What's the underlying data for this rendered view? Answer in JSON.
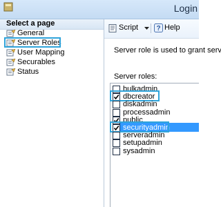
{
  "window": {
    "title": "Login"
  },
  "left_pane": {
    "header": "Select a page",
    "pages": [
      {
        "label": "General",
        "highlighted": false
      },
      {
        "label": "Server Roles",
        "highlighted": true
      },
      {
        "label": "User Mapping",
        "highlighted": false
      },
      {
        "label": "Securables",
        "highlighted": false
      },
      {
        "label": "Status",
        "highlighted": false
      }
    ]
  },
  "toolbar": {
    "script_label": "Script",
    "help_label": "Help"
  },
  "main": {
    "description": "Server role is used to grant serv",
    "roles_label": "Server roles:",
    "roles": [
      {
        "name": "bulkadmin",
        "checked": false,
        "highlighted": false,
        "selected": false
      },
      {
        "name": "dbcreator",
        "checked": true,
        "highlighted": true,
        "selected": false
      },
      {
        "name": "diskadmin",
        "checked": false,
        "highlighted": false,
        "selected": false
      },
      {
        "name": "processadmin",
        "checked": false,
        "highlighted": false,
        "selected": false
      },
      {
        "name": "public",
        "checked": true,
        "highlighted": false,
        "selected": false
      },
      {
        "name": "securityadmin",
        "checked": true,
        "highlighted": true,
        "selected": true
      },
      {
        "name": "serveradmin",
        "checked": false,
        "highlighted": false,
        "selected": false
      },
      {
        "name": "setupadmin",
        "checked": false,
        "highlighted": false,
        "selected": false
      },
      {
        "name": "sysadmin",
        "checked": false,
        "highlighted": false,
        "selected": false
      }
    ]
  },
  "colors": {
    "highlight": "#2fa3da",
    "selection": "#3399ff"
  }
}
